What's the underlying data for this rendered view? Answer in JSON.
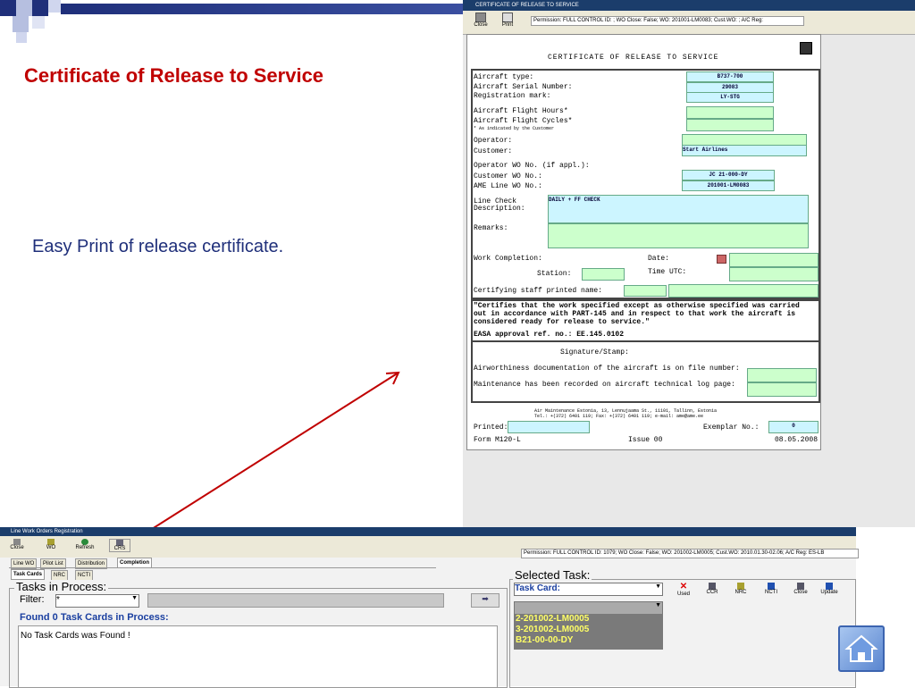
{
  "slide": {
    "title": "Certificate of Release to Service",
    "bullet": "Easy Print of release certificate."
  },
  "cert_window": {
    "title": "CERTIFICATE OF RELEASE TO SERVICE",
    "toolbar": {
      "close": "Close",
      "print": "Print"
    },
    "permission": "Permission: FULL CONTROL  ID: ; WO Close: False; WO: 201001-LM0083; Cust.WO: ; A/C Reg:",
    "form": {
      "heading": "CERTIFICATE OF RELEASE TO SERVICE",
      "aircraft_type_label": "Aircraft type:",
      "aircraft_type": "B737-700",
      "serial_label": "Aircraft Serial Number:",
      "serial": "29083",
      "reg_label": "Registration mark:",
      "reg": "LY-STG",
      "hours_label": "Aircraft Flight Hours*",
      "cycles_label": "Aircraft Flight Cycles*",
      "footnote": "* As indicated by the Customer",
      "operator_label": "Operator:",
      "customer_label": "Customer:",
      "customer": "Start Airlines",
      "opwo_label": "Operator WO No. (if appl.):",
      "opwo": "JC 21-000-DY",
      "custwo_label": "Customer WO No.:",
      "amewo_label": "AME Line WO No.:",
      "amewo": "201001-LM0083",
      "linecheck_label": "Line Check",
      "desc_label": "Description:",
      "desc": "DAILY + FF CHECK",
      "remarks_label": "Remarks:",
      "completion_label": "Work Completion:",
      "date_label": "Date:",
      "station_label": "Station:",
      "time_label": "Time UTC:",
      "staff_label": "Certifying staff printed name:",
      "certifies": "\"Certifies that the work specified except as otherwise specified was carried out in accordance with PART-145 and in respect to that work the aircraft is considered ready for release to service.\"",
      "easa": "EASA approval ref. no.: EE.145.0102",
      "signature": "Signature/Stamp:",
      "airworthiness": "Airworthiness documentation of the aircraft is on file number:",
      "maintenance": "Maintenance has been recorded on aircraft technical log page:",
      "address1": "Air Maintenance Estonia, 13, Lennujaama St., 11101, Tallinn, Estonia",
      "address2": "Tel.: +(372) 6401 119; Fax: +(372) 6401 119; e-mail: ame@ame.ee",
      "printed_label": "Printed:",
      "exemplar_label": "Exemplar No.:",
      "exemplar": "0",
      "form_no": "Form M120-L",
      "issue": "Issue 00",
      "date": "08.05.2008"
    }
  },
  "lw_window": {
    "title": "Line Work Orders Registration",
    "toolbar": {
      "close": "Close",
      "wo": "WO",
      "refresh": "Refresh",
      "crs": "CRS"
    },
    "tabs_top": [
      "Line WO",
      "Pilot List",
      "Distribution",
      "Completion"
    ],
    "tabs_sub": [
      "Task Cards",
      "NRC",
      "NCTI"
    ],
    "permission": "Permission: FULL CONTROL  ID: 1079; WO Close: False; WO: 201002-LM0005; Cust.WO: 2010.01.30-02.06; A/C Reg: ES-LB",
    "tasks_in_process": "Tasks in Process:",
    "filter_label": "Filter:",
    "filter_value": "*",
    "found": "Found 0 Task Cards in Process:",
    "no_found": "No Task Cards was Found !",
    "selected_task": "Selected Task:",
    "task_card_label": "Task Card:",
    "actions": [
      "Used",
      "CCR",
      "NRC",
      "NCTI",
      "Close",
      "Update"
    ],
    "list": [
      "2-201002-LM0005",
      "3-201002-LM0005",
      "B21-00-00-DY"
    ]
  },
  "colors": {
    "title_red": "#c00000",
    "bullet_blue": "#1f2f7a",
    "window_bar": "#1b3d6b",
    "green_field": "#ccffcc",
    "blue_field": "#ccf5ff"
  }
}
